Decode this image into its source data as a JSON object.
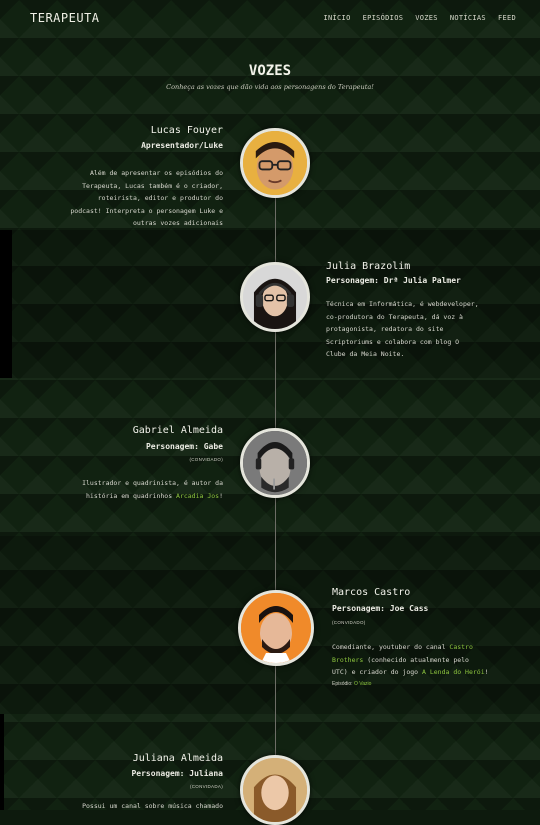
{
  "nav": {
    "logo": "TERAPEUTA",
    "items": [
      "INÍCIO",
      "EPISÓDIOS",
      "VOZES",
      "NOTÍCIAS",
      "FEED"
    ]
  },
  "page": {
    "title": "VOZES",
    "subtitle": "Conheça as vozes que dão vida aos personagens do Terapeuta!"
  },
  "members": [
    {
      "name": "Lucas Fouyer",
      "role": "Apresentador/Luke",
      "desc_lines": [
        "Além de apresentar os episódios do",
        "Terapeuta, Lucas também é o criador,",
        "roteirista, editor e produtor do",
        "podcast! Interpreta o personagem Luke e",
        "outras vozes adicionais"
      ]
    },
    {
      "name": "Julia Brazolim",
      "role": "Personagem: Drª Julia Palmer",
      "desc_lines": [
        "Técnica em Informática, é webdeveloper,",
        "co-produtora do Terapeuta, dá voz à",
        "protagonista, redatora do site",
        "Scriptoriums e colabora com blog O",
        "Clube da Meia Noite."
      ]
    },
    {
      "name": "Gabriel Almeida",
      "role": "Personagem: Gabe",
      "guest": "(CONVIDADO)",
      "desc_line1": "Ilustrador e quadrinista, é autor da",
      "desc_line2_pre": "história em quadrinhos ",
      "desc_link": "Arcadia Jos",
      "desc_line2_post": "!"
    },
    {
      "name": "Marcos Castro",
      "role": "Personagem: Joe Cass",
      "guest": "(CONVIDADO)",
      "desc_l1_pre": "Comediante, youtuber do canal ",
      "desc_l1_link": "Castro",
      "desc_l2_link": "Brothers",
      "desc_l2_post": " (conhecido atualmente pelo",
      "desc_l3_pre": "UTC) e criador do jogo ",
      "desc_l3_link": "A Lenda do Herói",
      "desc_l3_post": "!",
      "episode_label": "Episódio: ",
      "episode_link": "O Vazio"
    },
    {
      "name": "Juliana Almeida",
      "role": "Personagem: Juliana",
      "guest": "(CONVIDADA)",
      "desc_partial": "Possui um canal sobre música chamado"
    }
  ],
  "colors": {
    "accent": "#8ec63f",
    "background": "#112211"
  }
}
